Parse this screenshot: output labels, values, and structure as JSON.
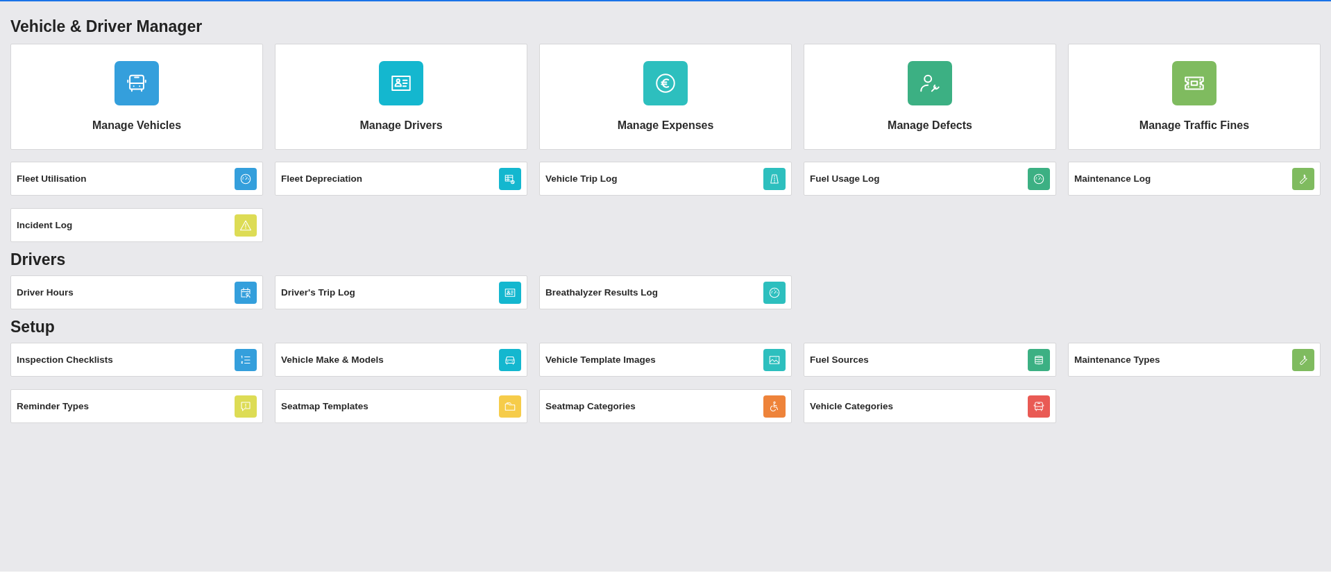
{
  "sections": [
    {
      "title": "Vehicle & Driver Manager",
      "cards": [
        {
          "label": "Manage Vehicles",
          "color": "#349fdc"
        },
        {
          "label": "Manage Drivers",
          "color": "#14b7cf"
        },
        {
          "label": "Manage Expenses",
          "color": "#2dbfbe"
        },
        {
          "label": "Manage Defects",
          "color": "#3cb083"
        },
        {
          "label": "Manage Traffic Fines",
          "color": "#7fbb5f"
        }
      ],
      "tiles": [
        {
          "label": "Fleet Utilisation",
          "color": "#349fdc"
        },
        {
          "label": "Fleet Depreciation",
          "color": "#14b7cf"
        },
        {
          "label": "Vehicle Trip Log",
          "color": "#2dbfbe"
        },
        {
          "label": "Fuel Usage Log",
          "color": "#3cb083"
        },
        {
          "label": "Maintenance Log",
          "color": "#7fbb5f"
        },
        {
          "label": "Incident Log",
          "color": "#dddc55"
        }
      ]
    },
    {
      "title": "Drivers",
      "tiles": [
        {
          "label": "Driver Hours",
          "color": "#349fdc"
        },
        {
          "label": "Driver's Trip Log",
          "color": "#14b7cf"
        },
        {
          "label": "Breathalyzer Results Log",
          "color": "#2dbfbe"
        }
      ]
    },
    {
      "title": "Setup",
      "tiles": [
        {
          "label": "Inspection Checklists",
          "color": "#349fdc"
        },
        {
          "label": "Vehicle Make & Models",
          "color": "#14b7cf"
        },
        {
          "label": "Vehicle Template Images",
          "color": "#2dbfbe"
        },
        {
          "label": "Fuel Sources",
          "color": "#3cb083"
        },
        {
          "label": "Maintenance Types",
          "color": "#7fbb5f"
        },
        {
          "label": "Reminder Types",
          "color": "#dddc55"
        },
        {
          "label": "Seatmap Templates",
          "color": "#f6cc4a"
        },
        {
          "label": "Seatmap Categories",
          "color": "#ee833a"
        },
        {
          "label": "Vehicle Categories",
          "color": "#e95a54"
        }
      ]
    }
  ]
}
